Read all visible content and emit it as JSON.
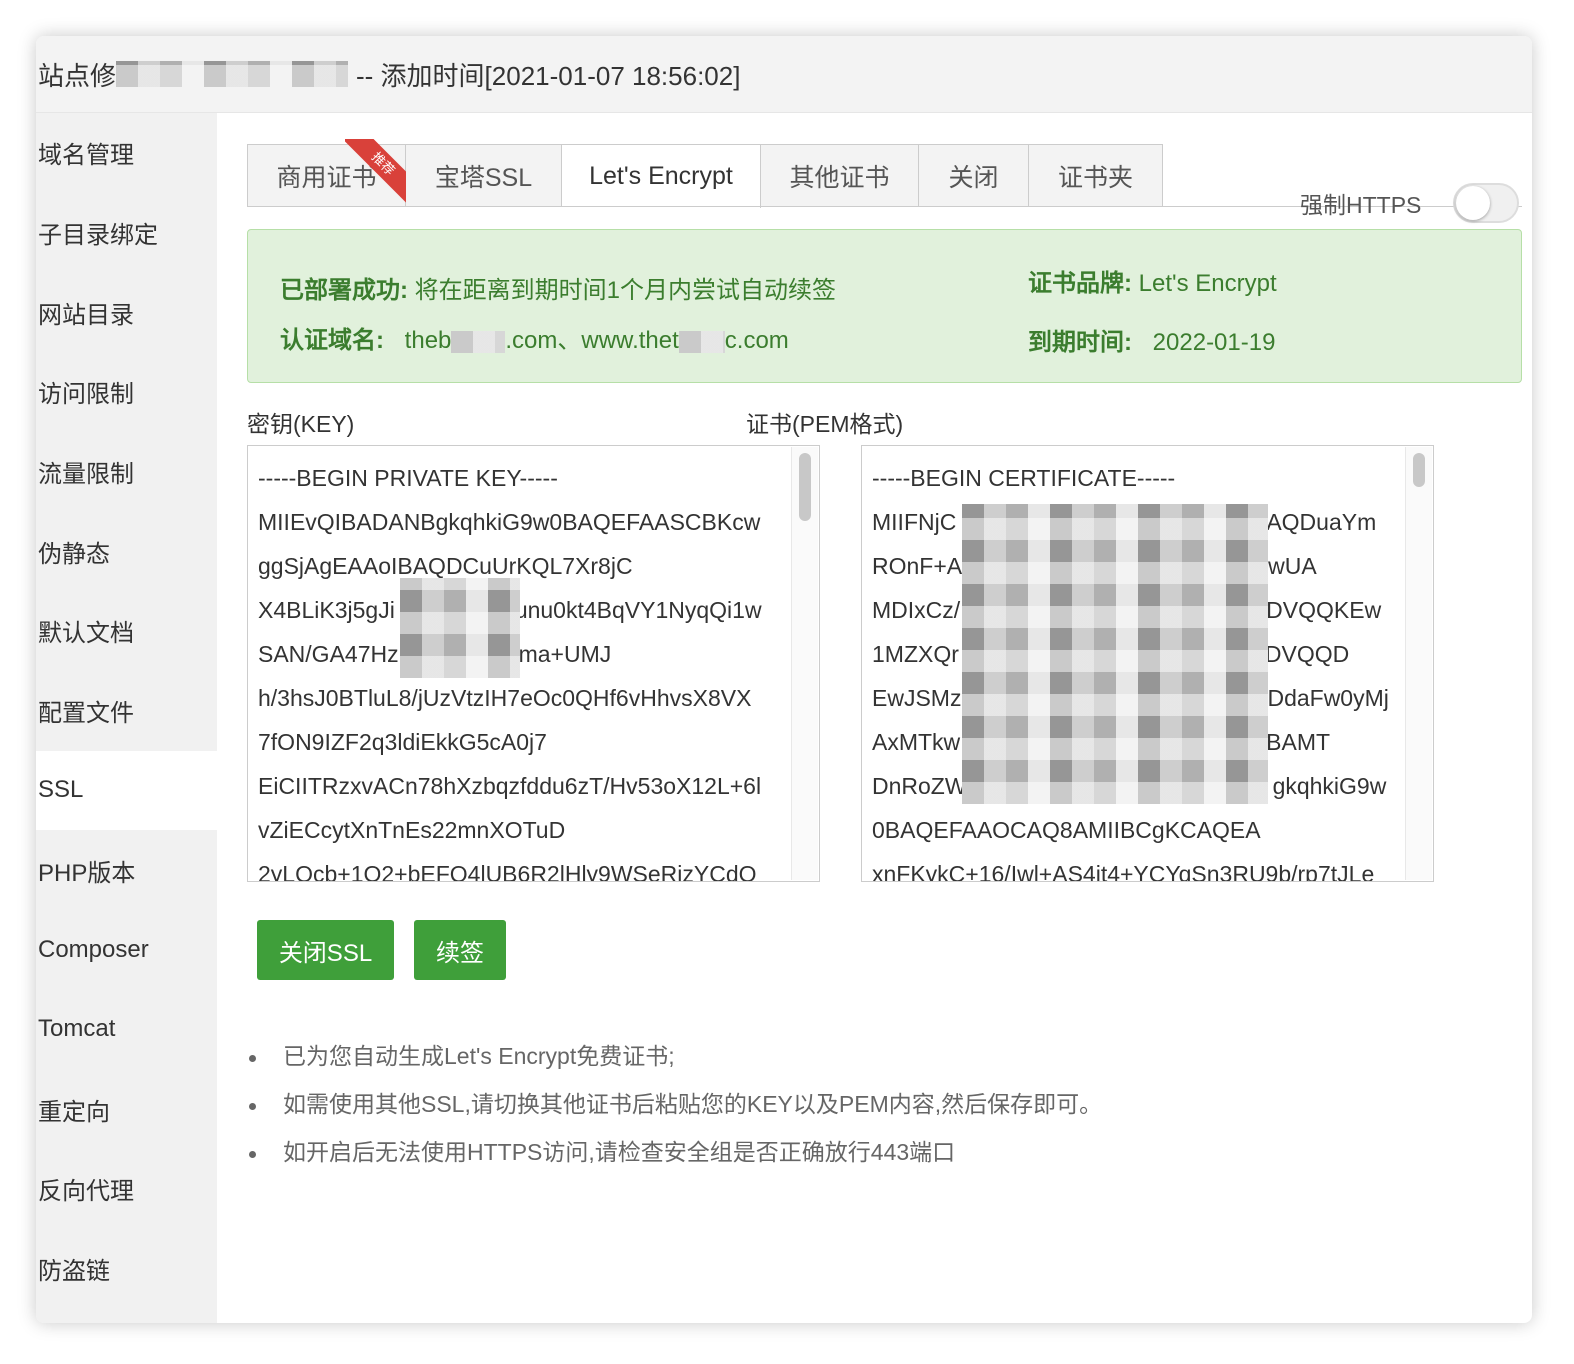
{
  "title": {
    "prefix": "站点修",
    "suffix": "-- 添加时间[2021-01-07 18:56:02]"
  },
  "sidebar": {
    "items": [
      {
        "label": "域名管理"
      },
      {
        "label": "子目录绑定"
      },
      {
        "label": "网站目录"
      },
      {
        "label": "访问限制"
      },
      {
        "label": "流量限制"
      },
      {
        "label": "伪静态"
      },
      {
        "label": "默认文档"
      },
      {
        "label": "配置文件"
      },
      {
        "label": "SSL"
      },
      {
        "label": "PHP版本"
      },
      {
        "label": "Composer"
      },
      {
        "label": "Tomcat"
      },
      {
        "label": "重定向"
      },
      {
        "label": "反向代理"
      },
      {
        "label": "防盗链"
      }
    ],
    "active": "SSL"
  },
  "tabs": [
    {
      "label": "商用证书",
      "badge": "推荐"
    },
    {
      "label": "宝塔SSL"
    },
    {
      "label": "Let's Encrypt"
    },
    {
      "label": "其他证书"
    },
    {
      "label": "关闭"
    },
    {
      "label": "证书夹"
    }
  ],
  "active_tab": "Let's Encrypt",
  "force_https": {
    "label": "强制HTTPS",
    "enabled": false
  },
  "status": {
    "deployed_key": "已部署成功:",
    "deployed_value": "将在距离到期时间1个月内尝试自动续签",
    "domain_key": "认证域名:",
    "domain_part1": "theb",
    "domain_part2": ".com、www.thet",
    "domain_part3": "c.com",
    "brand_key": "证书品牌:",
    "brand_value": "Let's Encrypt",
    "expiry_key": "到期时间:",
    "expiry_value": "2022-01-19"
  },
  "key_field": {
    "label": "密钥(KEY)",
    "lines": [
      "-----BEGIN PRIVATE KEY-----",
      "MIIEvQIBADANBgkqhkiG9w0BAQEFAASCBKcw",
      "ggSjAgEAAoIBAQDCuUrKQL7Xr8jC",
      "X4BLiK3j5gJi",
      "SAN/GA47Hz",
      "h/3hsJ0BTluL8/jUzVtzIH7eOc0QHf6vHhvsX8VX",
      "7fON9IZF2q3ldiEkkG5cA0j7",
      "EiCIITRzxvACn78hXzbqzfddu6zT/Hv53oX12L+6l",
      "vZiECcytXnTnEs22mnXOTuD",
      "2yLQcb+1O2+bEFQ4lUB6R2lHly9WSeRjzYCdO"
    ],
    "line_tails": [
      "",
      "",
      "",
      "unu0kt4BqVY1NyqQi1w",
      "ma+UMJ",
      "",
      "",
      "",
      "",
      ""
    ]
  },
  "cert_field": {
    "label": "证书(PEM格式)",
    "lines": [
      "-----BEGIN CERTIFICATE-----",
      "MIIFNjC",
      "ROnF+A",
      "MDIxCz/",
      "1MZXQr",
      "EwJSMz",
      "AxMTkw",
      "DnRoZW",
      "0BAQEFAAOCAQ8AMIIBCgKCAQEA",
      "xnFKykC+16/Iwl+AS4it4+YCYqSn3RU9b/rp7tJLe"
    ],
    "line_tails": [
      "",
      "AQDuaYm",
      "wUA",
      "DVQQKEw",
      "DVQQD",
      "DdaFw0yMj",
      "BAMT",
      "gkqhkiG9w",
      "",
      ""
    ]
  },
  "buttons": {
    "close_ssl": "关闭SSL",
    "renew": "续签"
  },
  "tips": [
    "已为您自动生成Let's Encrypt免费证书;",
    "如需使用其他SSL,请切换其他证书后粘贴您的KEY以及PEM内容,然后保存即可。",
    "如开启后无法使用HTTPS访问,请检查安全组是否正确放行443端口"
  ],
  "colors": {
    "primary_green": "#3f9f3a",
    "alert_bg": "#e1f1dc",
    "alert_text": "#3b7d2e",
    "badge_red": "#d9413a"
  }
}
